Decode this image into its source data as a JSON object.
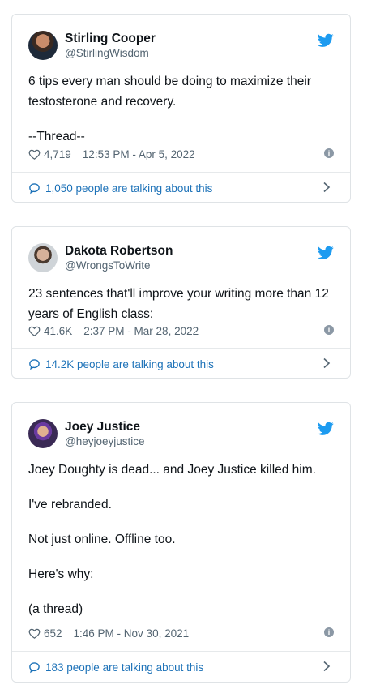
{
  "tweets": [
    {
      "name": "Stirling Cooper",
      "handle": "@StirlingWisdom",
      "paragraphs": [
        "6 tips every man should be doing to maximize their testosterone and recovery.",
        "--Thread--"
      ],
      "likes": "4,719",
      "datetime": "12:53 PM - Apr 5, 2022",
      "talking": "1,050 people are talking about this"
    },
    {
      "name": "Dakota Robertson",
      "handle": "@WrongsToWrite",
      "paragraphs": [
        "23 sentences that'll improve your writing more than 12 years of English class:"
      ],
      "likes": "41.6K",
      "datetime": "2:37 PM - Mar 28, 2022",
      "talking": "14.2K people are talking about this"
    },
    {
      "name": "Joey Justice",
      "handle": "@heyjoeyjustice",
      "paragraphs": [
        "Joey Doughty is dead... and Joey Justice killed him.",
        "I've rebranded.",
        "Not just online. Offline too.",
        "Here's why:",
        "(a thread)"
      ],
      "likes": "652",
      "datetime": "1:46 PM - Nov 30, 2021",
      "talking": "183 people are talking about this"
    }
  ],
  "colors": {
    "twitter_blue": "#1d9bf0",
    "link_blue": "#1d72b8",
    "muted": "#536471"
  },
  "icons": {
    "bird": "twitter-bird-icon",
    "like": "heart-icon",
    "info": "info-icon",
    "reply": "chat-bubble-icon",
    "chevron": "chevron-right-icon"
  }
}
